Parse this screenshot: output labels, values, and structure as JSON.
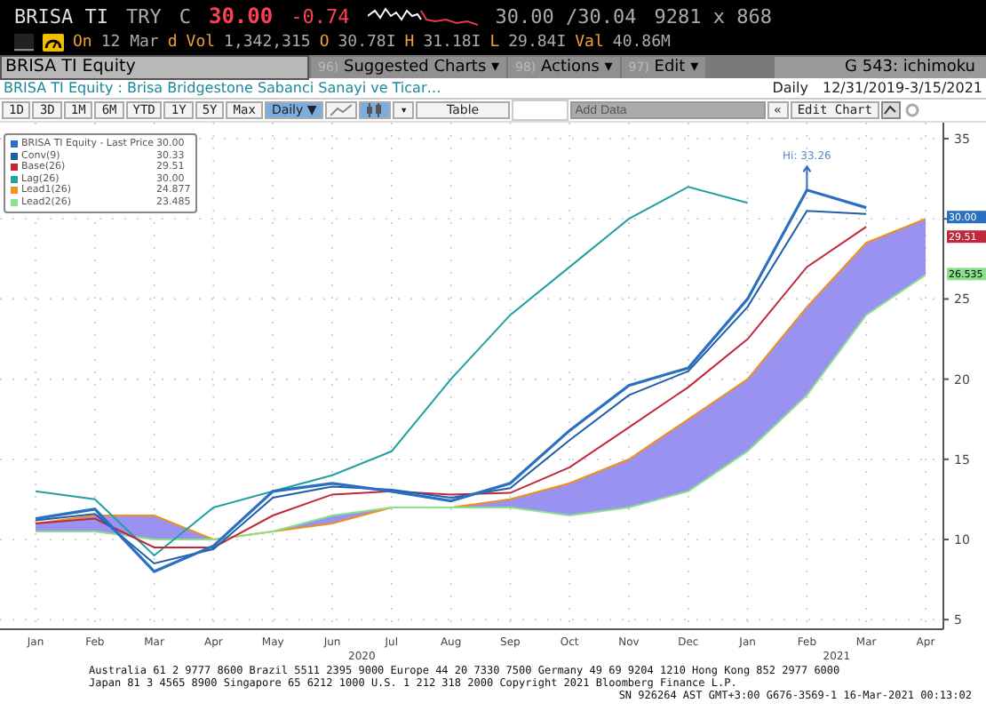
{
  "quote": {
    "ticker": "BRISA TI",
    "currency": "TRY",
    "close_flag": "C",
    "price": "30.00",
    "change": "-0.74",
    "bid_ask": "30.00 /30.04",
    "size": "9281 x 868"
  },
  "stats": [
    {
      "label": "On",
      "value": "12 Mar"
    },
    {
      "label": "d"
    },
    {
      "label": "Vol",
      "value": "1,342,315"
    },
    {
      "label": "O",
      "value": "30.78I"
    },
    {
      "label": "H",
      "value": "31.18I"
    },
    {
      "label": "L",
      "value": "29.84I"
    },
    {
      "label": "Val",
      "value": "40.86M"
    }
  ],
  "command_bar": {
    "security": "BRISA TI Equity",
    "menus": [
      {
        "number": "96)",
        "label": "Suggested Charts ▾"
      },
      {
        "number": "98)",
        "label": "Actions ▾"
      },
      {
        "number": "97)",
        "label": "Edit ▾"
      }
    ],
    "function": "G 543: ichimoku"
  },
  "subtitle": {
    "text": "BRISA TI Equity : Brisa Bridgestone Sabanci Sanayi ve Ticar…",
    "frequency": "Daily",
    "range": "12/31/2019-3/15/2021"
  },
  "toolbar": {
    "periods": [
      "1D",
      "3D",
      "1M",
      "6M",
      "YTD",
      "1Y",
      "5Y",
      "Max"
    ],
    "frequency": "Daily ▼",
    "chart_styles": [
      {
        "kind": "line",
        "selected": false
      },
      {
        "kind": "candle",
        "selected": true
      }
    ],
    "style_menu": "▾",
    "table": "Table",
    "add_data_placeholder": "Add Data",
    "collapse": "«",
    "edit_chart": "Edit Chart"
  },
  "legend_values": [
    "30.00",
    "30.33",
    "29.51",
    "30.00",
    "24.877",
    "23.485"
  ],
  "axis_tags": [
    {
      "text": "30.00",
      "color": "#2a6fc0"
    },
    {
      "text": "29.51",
      "color": "#c0283c"
    },
    {
      "text": "26.535",
      "color": "#8be08b"
    }
  ],
  "year_labels": [
    "2020",
    "2021"
  ],
  "chart_data": {
    "type": "line",
    "categories": [
      "Jan",
      "Feb",
      "Mar",
      "Apr",
      "May",
      "Jun",
      "Jul",
      "Aug",
      "Sep",
      "Oct",
      "Nov",
      "Dec",
      "Jan",
      "Feb",
      "Mar",
      "Apr"
    ],
    "ylim": [
      4.4,
      36
    ],
    "grid": true,
    "legend": true,
    "yticks": [
      5,
      10,
      15,
      20,
      25,
      30,
      35
    ],
    "annotations": [
      "Hi: 33.26"
    ],
    "series": [
      {
        "name": "BRISA TI Equity - Last Price",
        "color": "#2a6fc0",
        "values": [
          11.3,
          11.9,
          8,
          9.6,
          13,
          13.5,
          13,
          12.4,
          13.5,
          16.8,
          19.6,
          20.7,
          25,
          31.8,
          30.7,
          null
        ]
      },
      {
        "name": "Conv(9)",
        "color": "#1f5fa8",
        "values": [
          11.2,
          11.6,
          8.5,
          9.4,
          12.6,
          13.3,
          13.1,
          12.6,
          13.2,
          16.2,
          19,
          20.5,
          24.5,
          30.5,
          30.3,
          null
        ]
      },
      {
        "name": "Base(26)",
        "color": "#c0283c",
        "values": [
          11,
          11.3,
          9.5,
          9.5,
          11.5,
          12.8,
          13,
          12.8,
          12.9,
          14.5,
          17,
          19.5,
          22.5,
          27,
          29.5,
          null
        ]
      },
      {
        "name": "Lag(26)",
        "color": "#20a0a0",
        "values": [
          13,
          12.5,
          9,
          12,
          13,
          14,
          15.5,
          20,
          24,
          27,
          30,
          32,
          31,
          null,
          null,
          null
        ]
      },
      {
        "name": "Lead1(26)",
        "color": "#f0901e",
        "values": [
          11,
          11.5,
          11.5,
          10,
          10.5,
          11,
          12,
          12,
          12.5,
          13.5,
          15,
          17.5,
          20,
          24.5,
          28.5,
          30
        ]
      },
      {
        "name": "Lead2(26)",
        "color": "#8be08b",
        "values": [
          10.5,
          10.5,
          10,
          10,
          10.5,
          11.5,
          12,
          12,
          12,
          11.5,
          12,
          13,
          15.5,
          19,
          24,
          26.5
        ]
      }
    ]
  },
  "footer": [
    "Australia 61 2 9777 8600 Brazil 5511 2395 9000 Europe 44 20 7330 7500 Germany 49 69 9204 1210 Hong Kong 852 2977 6000",
    "Japan 81 3 4565 8900 Singapore 65 6212 1000 U.S. 1 212 318 2000 Copyright 2021 Bloomberg Finance L.P.",
    "SN 926264 AST GMT+3:00 G676-3569-1 16-Mar-2021 00:13:02"
  ]
}
